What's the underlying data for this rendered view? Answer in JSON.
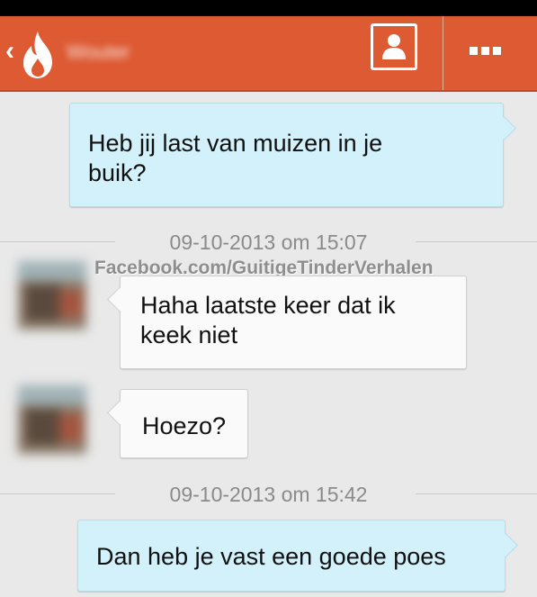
{
  "header": {
    "back_icon": "chevron-left-icon",
    "logo_icon": "flame-icon",
    "contact_name": "Wouter",
    "profile_icon": "contact-card-icon",
    "menu_icon": "more-dots-icon",
    "accent_color": "#dd5a33"
  },
  "messages": [
    {
      "direction": "out",
      "text": "Heb jij last van muizen in je\nbuik?"
    },
    {
      "type": "timestamp",
      "text": "09-10-2013 om 15:07"
    },
    {
      "direction": "in",
      "text": "Haha laatste keer dat ik\nkeek niet"
    },
    {
      "direction": "in",
      "text": "Hoezo?"
    },
    {
      "type": "timestamp",
      "text": "09-10-2013 om 15:42"
    },
    {
      "direction": "out",
      "text": "Dan heb je vast een goede poes"
    }
  ],
  "watermark": "Facebook.com/GuitigeTinderVerhalen",
  "colors": {
    "outgoing_bubble": "#d3f1fb",
    "incoming_bubble": "#fafafa",
    "background": "#e9e9e9"
  }
}
